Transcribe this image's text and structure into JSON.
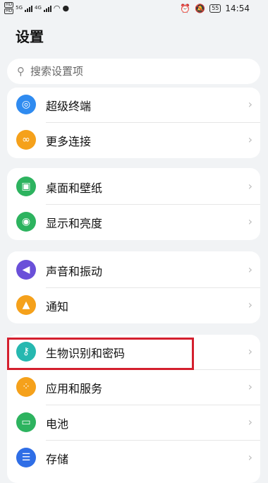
{
  "status_bar": {
    "sim1": "HD",
    "sim2": "HD",
    "net1": "5G",
    "net2": "4G",
    "battery": "55",
    "time": "14:54"
  },
  "page": {
    "title": "设置"
  },
  "search": {
    "placeholder": "搜索设置项"
  },
  "groups": [
    {
      "items": [
        {
          "label": "超级终端",
          "icon": "super-device-icon",
          "color": "#2f8bf0"
        },
        {
          "label": "更多连接",
          "icon": "link-icon",
          "color": "#f5a11b"
        }
      ]
    },
    {
      "items": [
        {
          "label": "桌面和壁纸",
          "icon": "wallpaper-icon",
          "color": "#2db35f"
        },
        {
          "label": "显示和亮度",
          "icon": "eye-icon",
          "color": "#2db35f"
        }
      ]
    },
    {
      "items": [
        {
          "label": "声音和振动",
          "icon": "volume-icon",
          "color": "#6a50d9"
        },
        {
          "label": "通知",
          "icon": "bell-icon",
          "color": "#f5a11b"
        }
      ]
    },
    {
      "items": [
        {
          "label": "生物识别和密码",
          "icon": "key-icon",
          "color": "#26b8b0"
        },
        {
          "label": "应用和服务",
          "icon": "apps-icon",
          "color": "#f5a11b"
        },
        {
          "label": "电池",
          "icon": "battery-icon",
          "color": "#2db35f"
        },
        {
          "label": "存储",
          "icon": "storage-icon",
          "color": "#2f6ee6"
        }
      ]
    }
  ],
  "highlight_color": "#d41f2e"
}
